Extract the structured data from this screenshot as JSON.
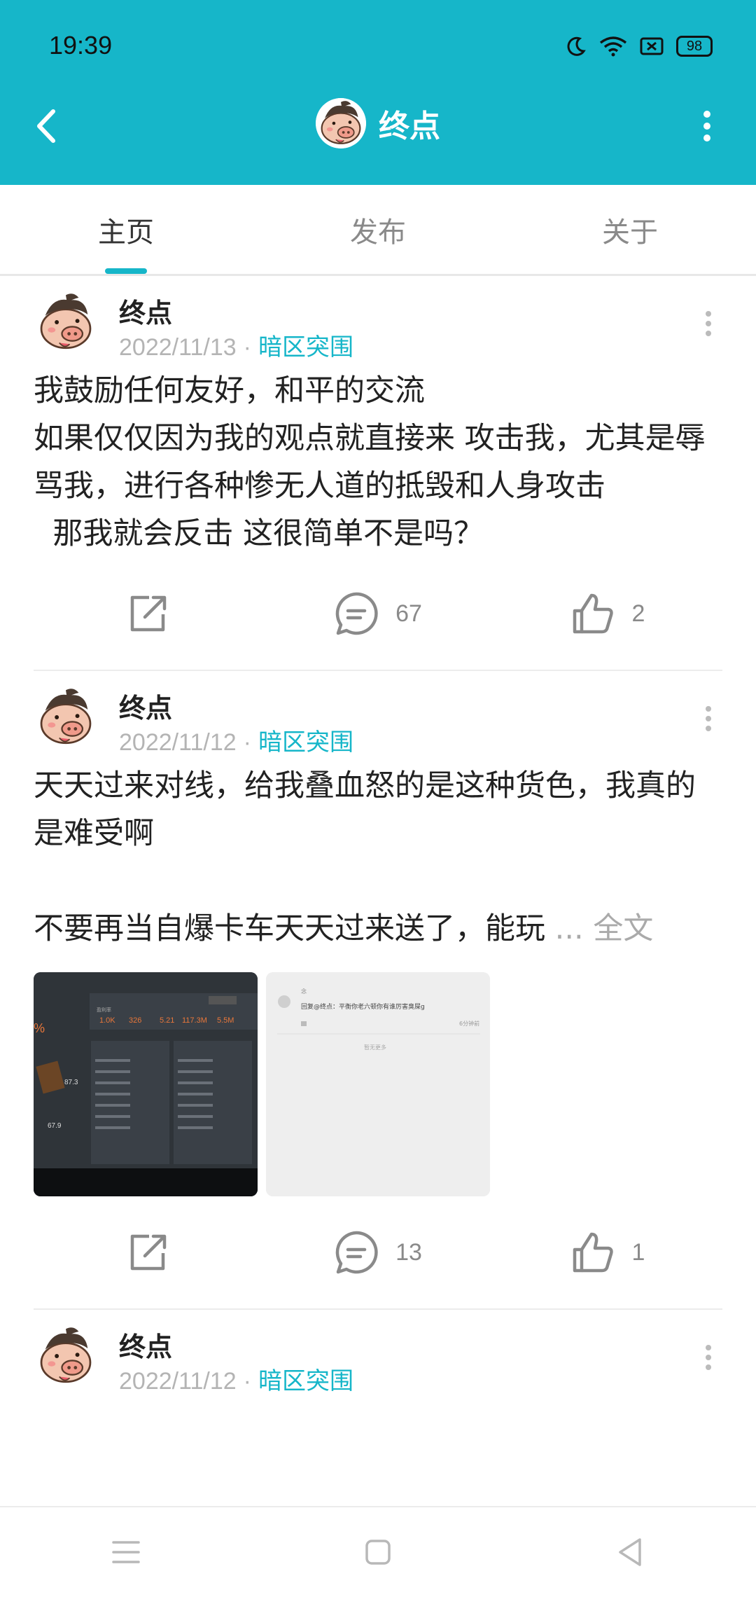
{
  "status_bar": {
    "time": "19:39",
    "battery": "98"
  },
  "header": {
    "title": "终点"
  },
  "tabs": [
    {
      "label": "主页",
      "active": true
    },
    {
      "label": "发布",
      "active": false
    },
    {
      "label": "关于",
      "active": false
    }
  ],
  "posts": [
    {
      "author": "终点",
      "date": "2022/11/13",
      "separator": "·",
      "topic": "暗区突围",
      "body": "我鼓励任何友好，和平的交流\n如果仅仅因为我的观点就直接来 攻击我，尤其是辱骂我，进行各种惨无人道的抵毁和人身攻击\n  那我就会反击 这很简单不是吗？",
      "read_more": "",
      "comments": "67",
      "likes": "2"
    },
    {
      "author": "终点",
      "date": "2022/11/12",
      "separator": "·",
      "topic": "暗区突围",
      "body": "天天过来对线，给我叠血怒的是这种货色，我真的是难受啊\n\n不要再当自爆卡车天天过来送了，能玩 ",
      "read_more": "... 全文",
      "comments": "13",
      "likes": "1",
      "images": [
        {
          "kind": "game-stats-screenshot",
          "stats": [
            "1.0K",
            "326",
            "5.21",
            "117.3M",
            "5.5M"
          ],
          "left_values": [
            "87.3",
            "67.9"
          ]
        },
        {
          "kind": "comment-screenshot",
          "reply_text": "回复@终点：平衡你老六顿你有谁厉害臭屎g",
          "time_ago": "6分钟前",
          "no_more": "暂无更多"
        }
      ]
    },
    {
      "author": "终点",
      "date": "2022/11/12",
      "separator": "·",
      "topic": "暗区突围"
    }
  ],
  "colors": {
    "accent": "#16b6c9",
    "text": "#222222",
    "muted": "#b4b4b4"
  },
  "icons": [
    "back-icon",
    "more-vertical-icon",
    "share-icon",
    "comment-icon",
    "like-icon",
    "menu-icon",
    "home-icon",
    "back-triangle-icon",
    "moon-icon",
    "wifi-icon",
    "sim-icon"
  ]
}
